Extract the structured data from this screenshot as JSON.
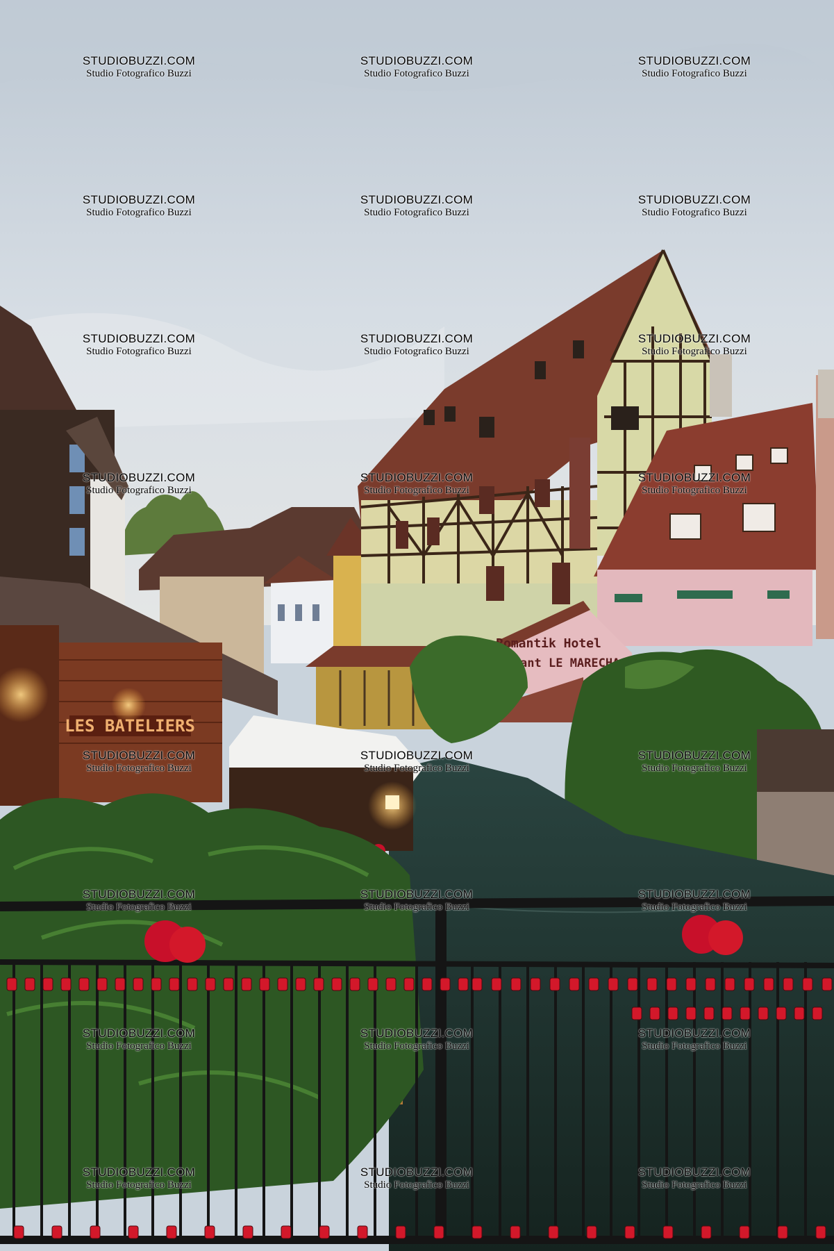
{
  "photo": {
    "description_free": true,
    "colors": {
      "sky": "#cfd8e0",
      "timber": "#3b2618",
      "roof": "#7a3b2c",
      "plaster_yellow": "#d9d6a6",
      "plaster_pink": "#e3b8bd",
      "water": "#1f3533",
      "foliage": "#2f5a22",
      "lock_red": "#d3182a",
      "railing": "#151515"
    }
  },
  "signs": {
    "bateliers": "LES BATELIERS",
    "hotel_line1": "Romantik Hotel",
    "hotel_line2": "estaurant LE MARECHA"
  },
  "watermark": {
    "line1": "STUDIOBUZZI.COM",
    "line2": "Studio Fotografico Buzzi"
  }
}
